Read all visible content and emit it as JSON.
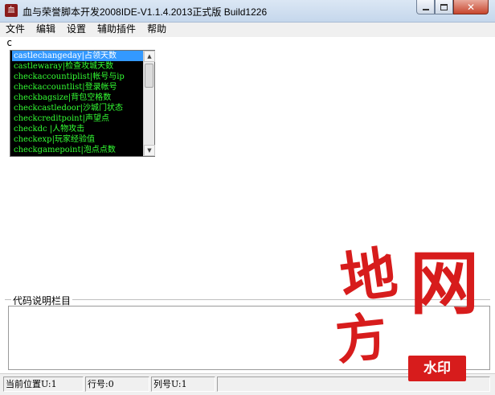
{
  "window": {
    "title": "血与荣誉脚本开发2008IDE-V1.1.4.2013正式版 Build1226",
    "app_icon_text": "血"
  },
  "menu": [
    "文件",
    "编辑",
    "设置",
    "辅助插件",
    "帮助"
  ],
  "editor": {
    "text": "c"
  },
  "autocomplete": {
    "selected_index": 0,
    "items": [
      "castlechangeday|占领天数",
      "castlewaray|检查攻城天数",
      "checkaccountiplist|帐号与ip",
      "checkaccountlist|登录帐号",
      "checkbagsize|背包空格数",
      "checkcastledoor|沙城门状态",
      "checkcreditpoint|声望点",
      "checkdc |人物攻击",
      "checkexp|玩家经验值",
      "checkgamepoint|泡点点数"
    ]
  },
  "description_panel": {
    "label": "代码说明栏目"
  },
  "statusbar": {
    "position": "当前位置U:1",
    "row": "行号:0",
    "col": "列号U:1"
  },
  "watermark": {
    "chars": [
      "地",
      "网",
      "方"
    ],
    "stamp": "水印"
  },
  "colors": {
    "autocomplete_bg": "#000000",
    "autocomplete_text": "#33ff33",
    "selection": "#3399ff",
    "watermark": "#d71c1c"
  }
}
